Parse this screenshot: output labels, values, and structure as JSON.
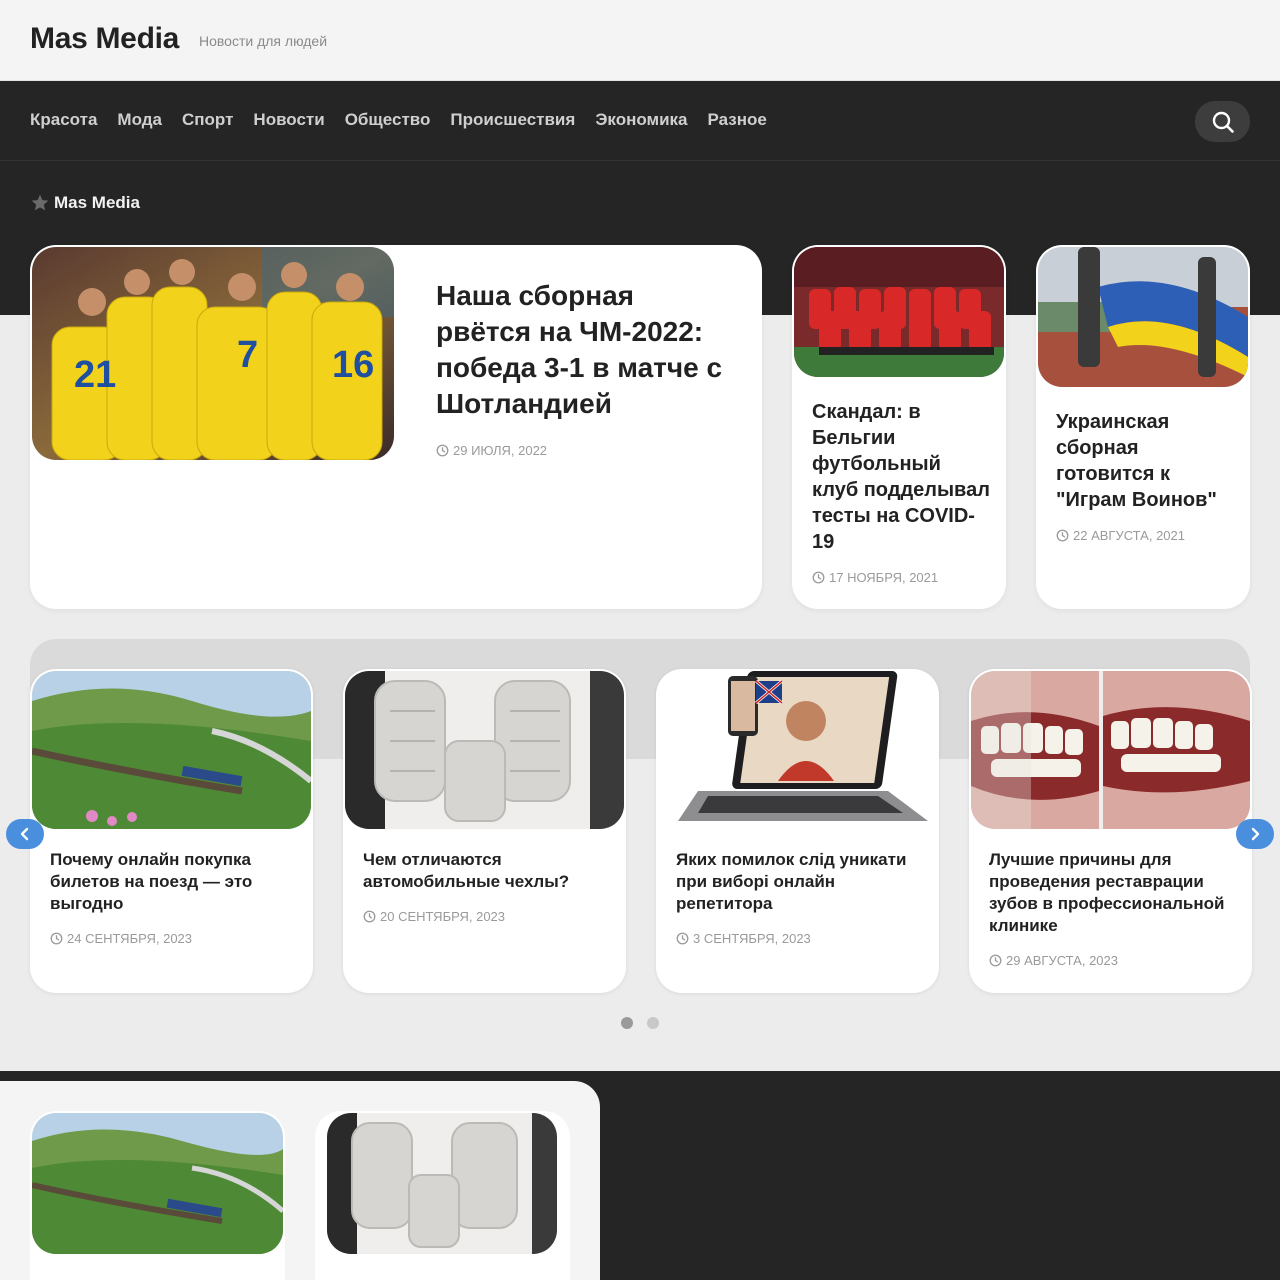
{
  "site": {
    "title": "Mas Media",
    "tagline": "Новости для людей"
  },
  "nav": {
    "items": [
      "Красота",
      "Мода",
      "Спорт",
      "Новости",
      "Общество",
      "Происшествия",
      "Экономика",
      "Разное"
    ]
  },
  "breadcrumb": {
    "label": "Mas Media"
  },
  "featured": {
    "title": "Наша сборная рвётся на ЧМ-2022: победа 3-1 в матче с Шотландией",
    "date": "29 июля, 2022"
  },
  "side_posts": [
    {
      "title": "Скандал: в Бельгии футбольный клуб подделывал тесты на COVID-19",
      "date": "17 ноября, 2021"
    },
    {
      "title": "Украинская сборная готовится к \"Играм Воинов\"",
      "date": "22 августа, 2021"
    }
  ],
  "slider": {
    "items": [
      {
        "title": "Почему онлайн покупка билетов на поезд — это выгодно",
        "date": "24 сентября, 2023"
      },
      {
        "title": "Чем отличаются автомобильные чехлы?",
        "date": "20 сентября, 2023"
      },
      {
        "title": "Яких помилок слід уникати при виборі онлайн репетитора",
        "date": "3 сентября, 2023"
      },
      {
        "title": "Лучшие причины для проведения реставрации зубов в профессиональной клинике",
        "date": "29 августа, 2023"
      }
    ],
    "page_count": 2,
    "active_page": 1
  },
  "colors": {
    "dark": "#252526",
    "accent": "#4a8fdd",
    "text": "#222222",
    "muted": "#9a9a9a",
    "bg": "#ececec"
  },
  "icons": {
    "search": "search-icon",
    "star": "star-icon",
    "clock": "clock-icon",
    "prev": "chevron-left-icon",
    "next": "chevron-right-icon"
  }
}
